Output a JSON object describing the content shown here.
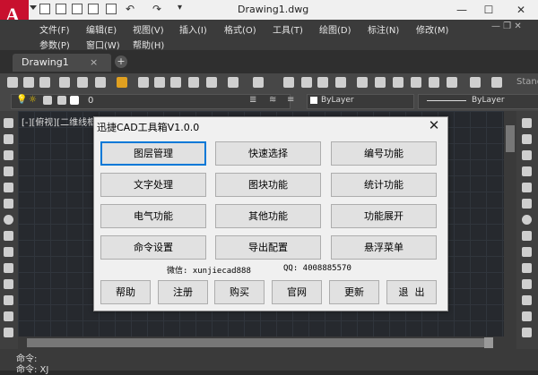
{
  "window": {
    "title": "Drawing1.dwg"
  },
  "app_logo_letter": "A",
  "menus": {
    "row1": [
      "文件(F)",
      "编辑(E)",
      "视图(V)",
      "插入(I)",
      "格式(O)",
      "工具(T)",
      "绘图(D)",
      "标注(N)",
      "修改(M)"
    ],
    "row2": [
      "参数(P)",
      "窗口(W)",
      "帮助(H)"
    ]
  },
  "tabs": {
    "active": "Drawing1",
    "close": "×",
    "add": "+"
  },
  "toolbar": {
    "stand_label": "Stand",
    "layer_value": "0",
    "color_value": "ByLayer",
    "linetype_value": "ByLayer"
  },
  "viewport_label": "[-][俯视][二维线框]",
  "command_lines": [
    "命令:",
    "命令: XJ"
  ],
  "dialog": {
    "title": "迅捷CAD工具箱V1.0.0",
    "close": "✕",
    "function_buttons": [
      [
        "图层管理",
        "快速选择",
        "编号功能"
      ],
      [
        "文字处理",
        "图块功能",
        "统计功能"
      ],
      [
        "电气功能",
        "其他功能",
        "功能展开"
      ],
      [
        "命令设置",
        "导出配置",
        "悬浮菜单"
      ]
    ],
    "wechat": "微信: xunjiecad888",
    "qq": "QQ: 4008885570",
    "bottom_buttons": [
      "帮助",
      "注册",
      "购买",
      "官网",
      "更新",
      "退  出"
    ]
  }
}
